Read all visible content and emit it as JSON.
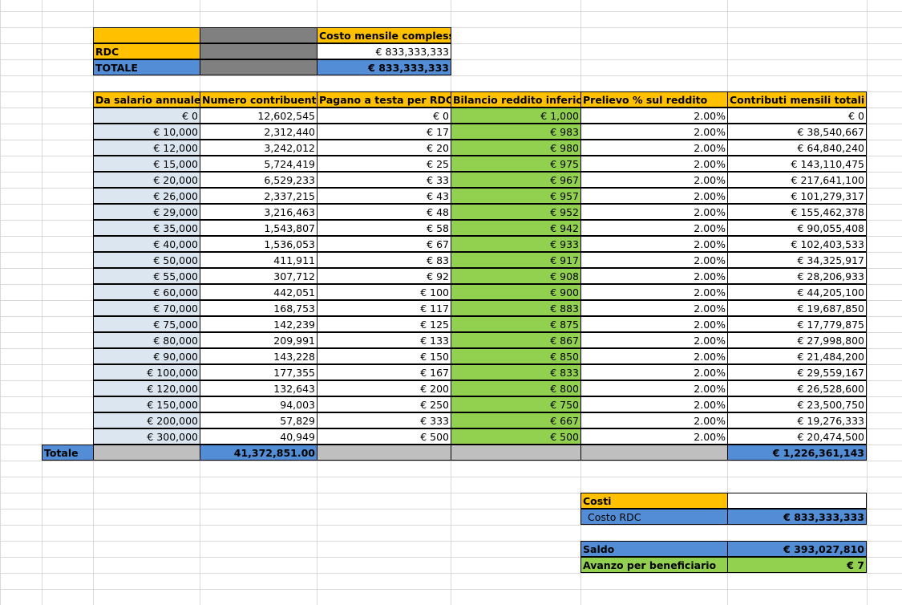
{
  "summary_header": {
    "costo_mensile_label": "Costo mensile complessivo",
    "rows": [
      {
        "label": "RDC",
        "value": "€ 833,333,333"
      },
      {
        "label": "TOTALE",
        "value": "€ 833,333,333"
      }
    ]
  },
  "table": {
    "headers": [
      "Da salario annuale",
      "Numero contribuenti",
      "Pagano a testa per RDC",
      "Bilancio reddito inferiore",
      "Prelievo % sul reddito",
      "Contributi mensili totali"
    ],
    "rows": [
      [
        "€ 0",
        "12,602,545",
        "€ 0",
        "€ 1,000",
        "2.00%",
        "€ 0"
      ],
      [
        "€ 10,000",
        "2,312,440",
        "€ 17",
        "€ 983",
        "2.00%",
        "€ 38,540,667"
      ],
      [
        "€ 12,000",
        "3,242,012",
        "€ 20",
        "€ 980",
        "2.00%",
        "€ 64,840,240"
      ],
      [
        "€ 15,000",
        "5,724,419",
        "€ 25",
        "€ 975",
        "2.00%",
        "€ 143,110,475"
      ],
      [
        "€ 20,000",
        "6,529,233",
        "€ 33",
        "€ 967",
        "2.00%",
        "€ 217,641,100"
      ],
      [
        "€ 26,000",
        "2,337,215",
        "€ 43",
        "€ 957",
        "2.00%",
        "€ 101,279,317"
      ],
      [
        "€ 29,000",
        "3,216,463",
        "€ 48",
        "€ 952",
        "2.00%",
        "€ 155,462,378"
      ],
      [
        "€ 35,000",
        "1,543,807",
        "€ 58",
        "€ 942",
        "2.00%",
        "€ 90,055,408"
      ],
      [
        "€ 40,000",
        "1,536,053",
        "€ 67",
        "€ 933",
        "2.00%",
        "€ 102,403,533"
      ],
      [
        "€ 50,000",
        "411,911",
        "€ 83",
        "€ 917",
        "2.00%",
        "€ 34,325,917"
      ],
      [
        "€ 55,000",
        "307,712",
        "€ 92",
        "€ 908",
        "2.00%",
        "€ 28,206,933"
      ],
      [
        "€ 60,000",
        "442,051",
        "€ 100",
        "€ 900",
        "2.00%",
        "€ 44,205,100"
      ],
      [
        "€ 70,000",
        "168,753",
        "€ 117",
        "€ 883",
        "2.00%",
        "€ 19,687,850"
      ],
      [
        "€ 75,000",
        "142,239",
        "€ 125",
        "€ 875",
        "2.00%",
        "€ 17,779,875"
      ],
      [
        "€ 80,000",
        "209,991",
        "€ 133",
        "€ 867",
        "2.00%",
        "€ 27,998,800"
      ],
      [
        "€ 90,000",
        "143,228",
        "€ 150",
        "€ 850",
        "2.00%",
        "€ 21,484,200"
      ],
      [
        "€ 100,000",
        "177,355",
        "€ 167",
        "€ 833",
        "2.00%",
        "€ 29,559,167"
      ],
      [
        "€ 120,000",
        "132,643",
        "€ 200",
        "€ 800",
        "2.00%",
        "€ 26,528,600"
      ],
      [
        "€ 150,000",
        "94,003",
        "€ 250",
        "€ 750",
        "2.00%",
        "€ 23,500,750"
      ],
      [
        "€ 200,000",
        "57,829",
        "€ 333",
        "€ 667",
        "2.00%",
        "€ 19,276,333"
      ],
      [
        "€ 300,000",
        "40,949",
        "€ 500",
        "€ 500",
        "2.00%",
        "€ 20,474,500"
      ]
    ],
    "totale_label": "Totale",
    "totale_contribuenti": "41,372,851.00",
    "totale_contributi": "€ 1,226,361,143"
  },
  "costs_box": {
    "costi_label": "Costi",
    "costo_rdc_label": "Costo RDC",
    "costo_rdc_value": "€ 833,333,333",
    "saldo_label": "Saldo",
    "saldo_value": "€ 393,027,810",
    "avanzo_label": "Avanzo per beneficiario",
    "avanzo_value": "€ 7"
  },
  "colors": {
    "orange": "#ffc000",
    "blue": "#538dd5",
    "light_blue": "#dce6f1",
    "green": "#92d050",
    "gray": "#808080",
    "light_gray": "#bfbfbf",
    "gridline": "#d9d9d9"
  }
}
